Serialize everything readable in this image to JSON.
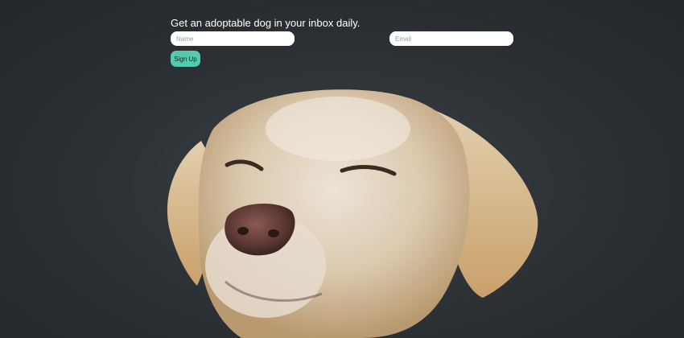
{
  "signup": {
    "headline": "Get an adoptable dog in your inbox daily.",
    "name_placeholder": "Name",
    "email_placeholder": "Email",
    "submit_label": "Sign Up"
  },
  "colors": {
    "background": "#2b3034",
    "button": "#55c9ae",
    "input_bg": "#ffffff"
  }
}
